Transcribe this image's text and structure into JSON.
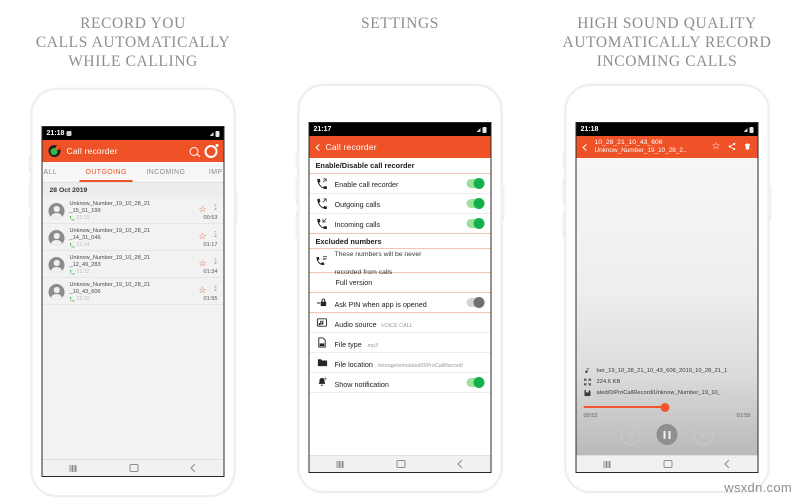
{
  "watermark": "wsxdn.com",
  "panels": [
    {
      "headline": "RECORD YOU\nCALLS AUTOMATICALLY\nWHILE CALLING",
      "status": {
        "time": "21:18"
      },
      "appbar": {
        "title": "Call recorder",
        "search_icon": "search-icon",
        "settings_icon": "gear-icon"
      },
      "tabs": [
        {
          "label": "ALL",
          "active": false
        },
        {
          "label": "OUTGOING",
          "active": true
        },
        {
          "label": "INCOMING",
          "active": false
        },
        {
          "label": "IMP",
          "active": false
        }
      ],
      "date_header": "28 Oct 2019",
      "calls": [
        {
          "name": "Unknow_Number_19_10_28_21\n_15_51_199",
          "time": "21:15",
          "duration": "00:53"
        },
        {
          "name": "Unknow_Number_19_10_28_21\n_14_31_046",
          "time": "21:14",
          "duration": "01:17"
        },
        {
          "name": "Unknow_Number_19_10_28_21\n_12_49_283",
          "time": "21:12",
          "duration": "01:34"
        },
        {
          "name": "Unknow_Number_19_10_28_21\n_10_43_606",
          "time": "21:10",
          "duration": "01:55"
        }
      ]
    },
    {
      "headline": "SETTINGS",
      "status": {
        "time": "21:17"
      },
      "appbar": {
        "title": "Call recorder",
        "back_icon": "chevron-left-icon"
      },
      "sections": [
        {
          "type": "header",
          "label": "Enable/Disable call recorder"
        },
        {
          "type": "toggle",
          "icon": "phone-outgoing-icon",
          "label": "Enable call recorder",
          "state": "on"
        },
        {
          "type": "toggle",
          "icon": "phone-outgoing-icon",
          "label": "Outgoing calls",
          "state": "on"
        },
        {
          "type": "toggle",
          "icon": "phone-incoming-icon",
          "label": "Incoming calls",
          "state": "on"
        },
        {
          "type": "header",
          "label": "Excluded numbers"
        },
        {
          "type": "twoline",
          "icon": "contacts-list-icon",
          "label": "These numbers will be never\nrecorded from calls"
        },
        {
          "type": "plain",
          "label": "Full version"
        },
        {
          "type": "toggle",
          "icon": "lock-icon",
          "label": "Ask PIN when app is opened",
          "state": "off"
        },
        {
          "type": "value",
          "icon": "audio-source-icon",
          "label": "Audio source",
          "value": "VOICE CALL"
        },
        {
          "type": "value",
          "icon": "file-type-icon",
          "label": "File type",
          "value": ".mp3"
        },
        {
          "type": "value",
          "icon": "folder-icon",
          "label": "File location",
          "value": "/storage/emulated/0/ProCallRecord/"
        },
        {
          "type": "toggle",
          "icon": "notification-icon",
          "label": "Show notification",
          "state": "on"
        }
      ]
    },
    {
      "headline": "HIGH SOUND QUALITY\nAUTOMATICALLY RECORD\nINCOMING CALLS",
      "status": {
        "time": "21:18"
      },
      "appbar": {
        "back_icon": "chevron-left-icon",
        "title_line1": "10_28_21_10_43_606",
        "title_line2": "Unknow_Number_19_10_28_2..",
        "star_icon": "star-icon",
        "share_icon": "share-icon",
        "delete_icon": "trash-icon"
      },
      "info": [
        {
          "icon": "music-note-icon",
          "text": "ber_19_10_28_21_10_43_606_2019_10_28_21_1"
        },
        {
          "icon": "resize-icon",
          "text": "224.6 KB"
        },
        {
          "icon": "save-icon",
          "text": "ated/0/ProCallRecord/Unknow_Number_19_10_"
        }
      ],
      "player": {
        "elapsed": "00:52",
        "total": "01:55",
        "progress_percent": 49,
        "prev_icon": "previous-icon",
        "pause_icon": "pause-icon",
        "next_icon": "next-icon"
      }
    }
  ],
  "navbar": {
    "recents_icon": "recents-icon",
    "home_icon": "home-icon",
    "back_icon": "back-icon"
  },
  "colors": {
    "accent": "#ef5226",
    "toggle_on": "#14b14a",
    "toggle_off": "#6f6f6f",
    "status_bar": "#000000"
  }
}
